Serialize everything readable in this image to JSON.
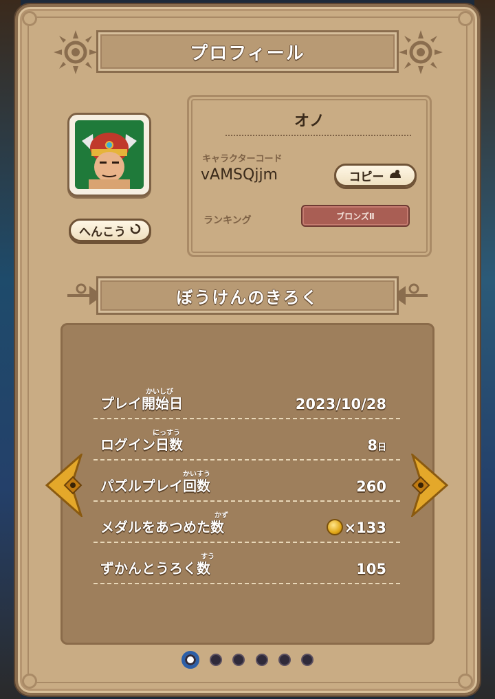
{
  "header": {
    "title": "プロフィール"
  },
  "profile": {
    "player_name": "オノ",
    "code_label": "キャラクターコード",
    "code_value": "vAMSQjjm",
    "copy_label": "コピー",
    "change_label": "へんこう",
    "ranking_label": "ランキング",
    "ranking_value": "ブロンズⅡ",
    "avatar_icon": "warrior-portrait-icon"
  },
  "records": {
    "title": "ぼうけんのきろく",
    "rows": [
      {
        "label": "プレイ開始日",
        "ruby": "かいしび",
        "value": "2023/10/28",
        "unit": ""
      },
      {
        "label": "ログイン日数",
        "ruby": "にっすう",
        "value": "8",
        "unit": "日"
      },
      {
        "label": "パズルプレイ回数",
        "ruby": "かいすう",
        "value": "260",
        "unit": ""
      },
      {
        "label": "メダルをあつめた数",
        "ruby": "かず",
        "value": "×133",
        "unit": ""
      },
      {
        "label": "ずかんとうろく数",
        "ruby": "すう",
        "value": "105",
        "unit": ""
      }
    ]
  },
  "pagination": {
    "pages": 6,
    "current": 1
  },
  "colors": {
    "panel": "#c9ac84",
    "board": "#9e7f5c",
    "accent": "#2c5fa8",
    "rank_badge": "#a95e54"
  }
}
